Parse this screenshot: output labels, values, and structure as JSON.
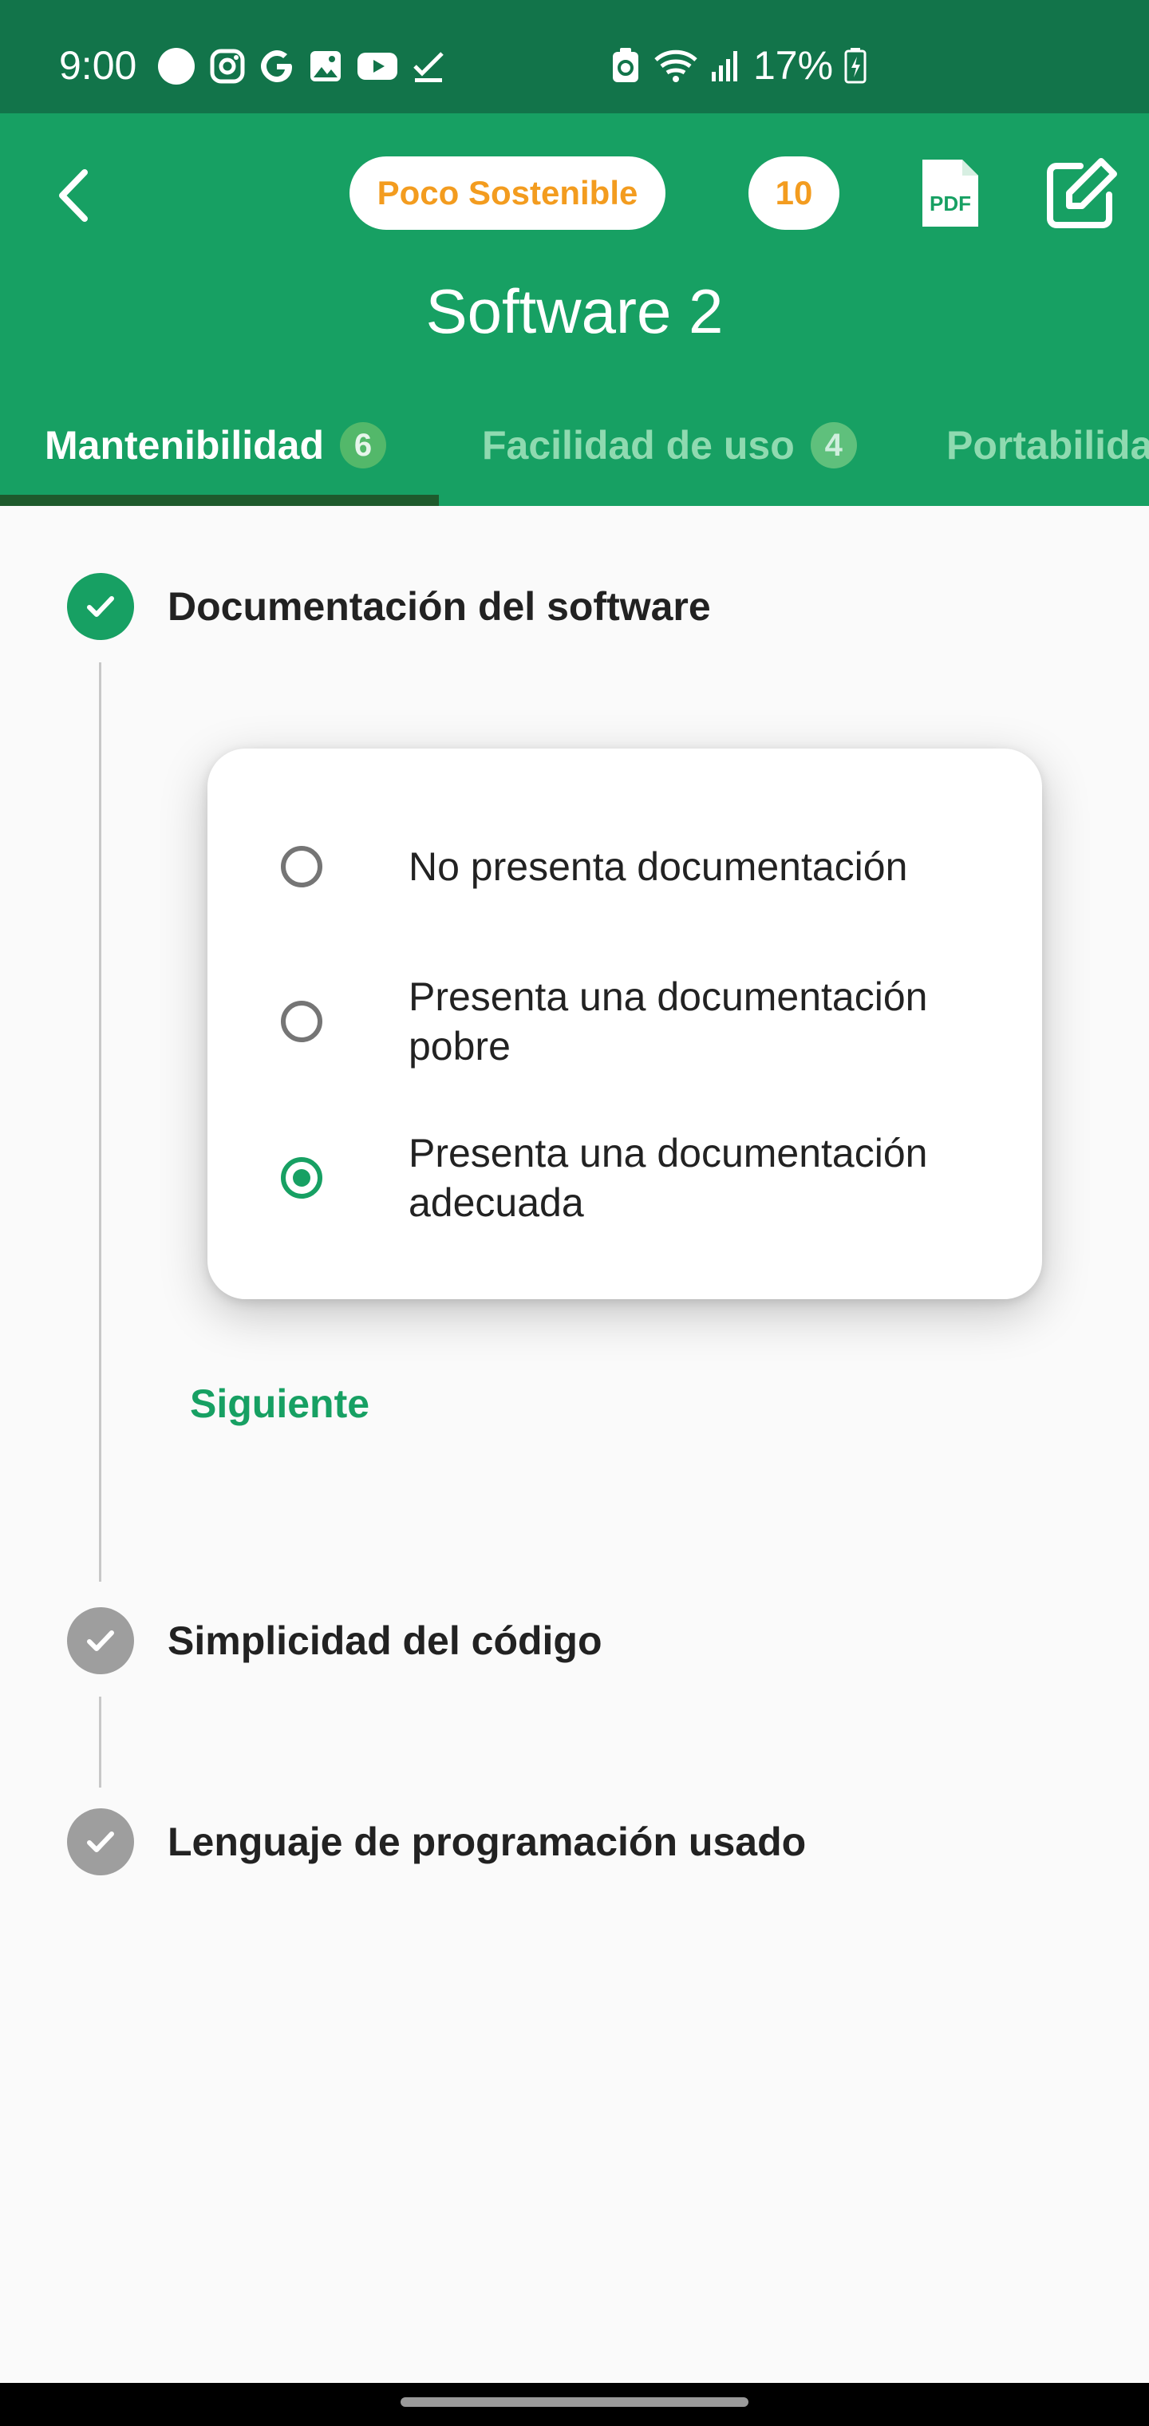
{
  "status_bar": {
    "time": "9:00",
    "battery": "17%",
    "left_icons": [
      "circle-icon",
      "instagram-icon",
      "google-icon",
      "gallery-icon",
      "youtube-icon",
      "check-icon"
    ],
    "right_icons": [
      "recycle-icon",
      "wifi-icon",
      "signal-icon",
      "battery-icon"
    ]
  },
  "header": {
    "sustainability_badge": "Poco Sostenible",
    "score_badge": "10",
    "title": "Software 2",
    "accent_color": "#17a063",
    "badge_text_color": "#f39c1f"
  },
  "tabs": [
    {
      "label": "Mantenibilidad",
      "count": "6",
      "active": true
    },
    {
      "label": "Facilidad de uso",
      "count": "4",
      "active": false
    },
    {
      "label": "Portabilida",
      "count": "",
      "active": false
    }
  ],
  "steps": [
    {
      "title": "Documentación del software",
      "state": "active"
    },
    {
      "title": "Simplicidad del código",
      "state": "completed"
    },
    {
      "title": "Lenguaje de programación usado",
      "state": "completed"
    }
  ],
  "options": [
    {
      "label": "No presenta documentación",
      "selected": false
    },
    {
      "label": "Presenta una documentación pobre",
      "selected": false
    },
    {
      "label": "Presenta una documentación adecuada",
      "selected": true
    }
  ],
  "next_button": "Siguiente"
}
